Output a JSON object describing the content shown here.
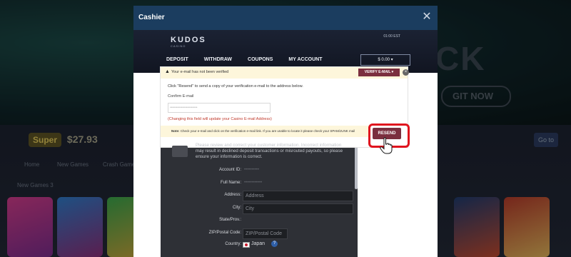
{
  "background": {
    "hero_text": "CK",
    "visit_text": "GIT NOW",
    "balance": "$27.93",
    "logo_text": "Super",
    "action_button": "Go to",
    "nav": [
      "Home",
      "New Games",
      "Crash Games"
    ],
    "section": "New Games 3"
  },
  "modal": {
    "title": "Cashier",
    "close_symbol": "✕"
  },
  "cashier": {
    "brand": "KUDOS",
    "brand_sub": "CASINO",
    "time": "01:00 EST",
    "tabs": [
      "DEPOSIT",
      "WITHDRAW",
      "COUPONS",
      "MY ACCOUNT"
    ],
    "balance_label": "$ 0.00 ▾"
  },
  "verify": {
    "warning": "Your e-mail has not been verified",
    "verify_button": "VERIFY E-MAIL ▾",
    "instructions": "Click \"Resend\" to send a copy of your verification e-mail to the address below.",
    "confirm_label": "Confirm E-mail",
    "email_value": "••••••••••••••••••••••",
    "change_note": "(Changing this field will update your Casino E-mail Address)",
    "note_label": "Note:",
    "note_text": "Check your e-mail and click on the verification e-mail link. If you are unable to locate it please check your SPAM/JUNK mail",
    "resend_button": "RESEND"
  },
  "form": {
    "info_text": "Please review and correct your customer information. Incorrect information may result in declined deposit transactions or misrouted payouts, so please ensure your information is correct.",
    "fields": [
      {
        "label": "Account ID:",
        "value": "••••••••••"
      },
      {
        "label": "Full Name:",
        "value": "••••••••••••"
      },
      {
        "label": "Address:",
        "placeholder": "Address"
      },
      {
        "label": "City:",
        "placeholder": "City"
      },
      {
        "label": "State/Prov.:",
        "value": ""
      },
      {
        "label": "ZIP/Postal Code:",
        "placeholder": "ZIP/Postal Code"
      },
      {
        "label": "Country:",
        "value": "Japan"
      }
    ],
    "help_symbol": "?"
  }
}
